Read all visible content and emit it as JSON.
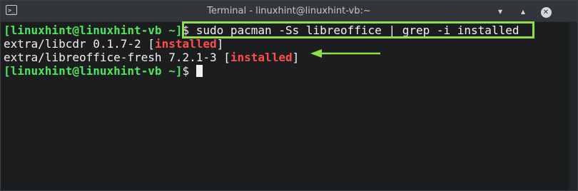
{
  "window": {
    "title": "Terminal - linuxhint@linuxhint-vb:~",
    "icon_glyph": ">_",
    "minimize_glyph": "▾",
    "maximize_glyph": "▴",
    "close_glyph": "✕"
  },
  "terminal": {
    "line1": {
      "prompt": "[linuxhint@linuxhint-vb ~]",
      "dollar": "$",
      "command": " sudo pacman -Ss libreoffice | grep -i installed"
    },
    "line2": {
      "package": "extra/libcdr 0.1.7-2 ",
      "bracket_open": "[",
      "status": "installed",
      "bracket_close": "]"
    },
    "line3": {
      "package": "extra/libreoffice-fresh 7.2.1-3 ",
      "bracket_open": "[",
      "status": "installed",
      "bracket_close": "]"
    },
    "line4": {
      "prompt": "[linuxhint@linuxhint-vb ~]",
      "dollar": "$",
      "space": " "
    }
  },
  "annotations": {
    "box_color": "#8fe046",
    "arrow_color": "#8fe046"
  }
}
